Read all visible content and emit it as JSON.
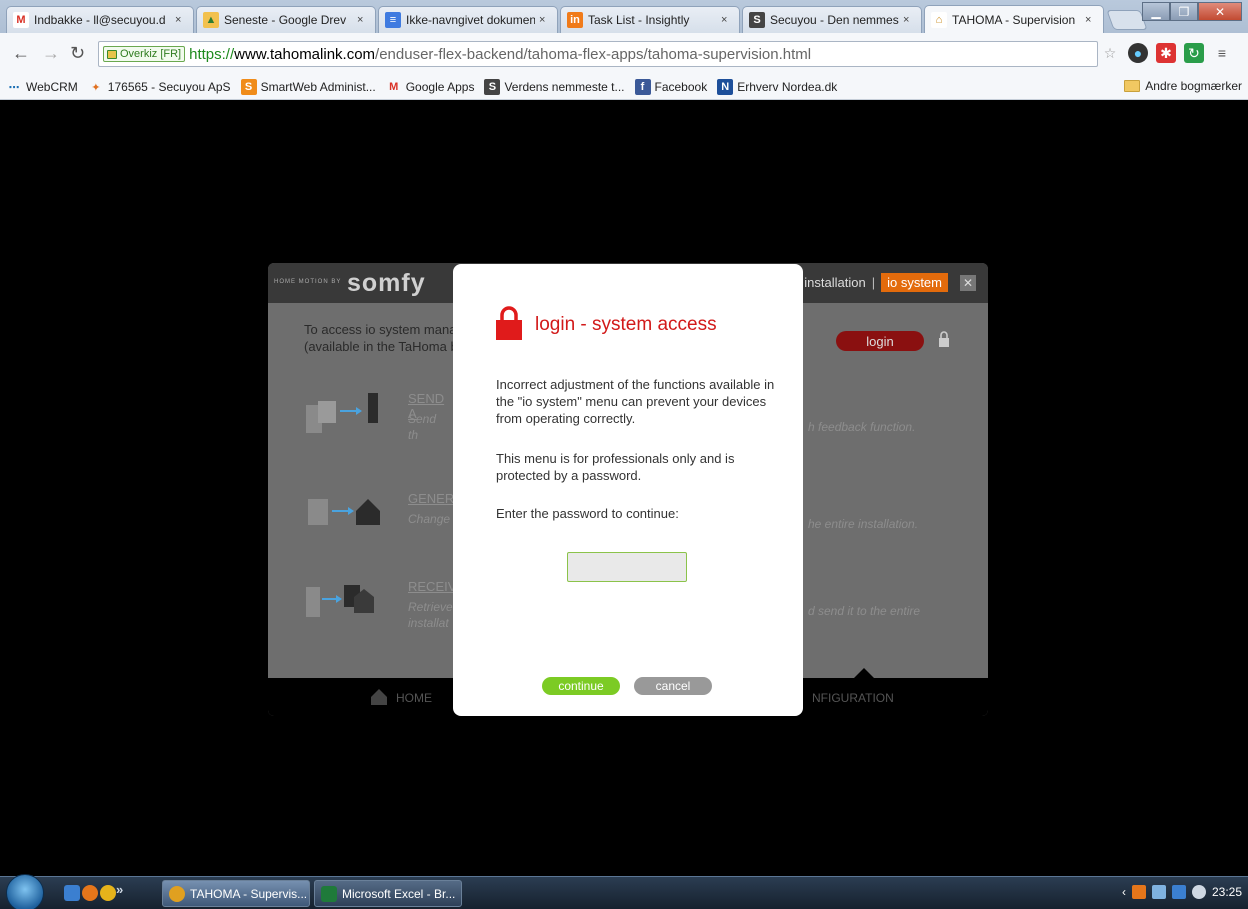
{
  "browser": {
    "tabs": [
      {
        "label": "Indbakke - ll@secuyou.d",
        "fav": "M",
        "favColor": "#d93025"
      },
      {
        "label": "Seneste - Google Drev",
        "fav": "▲",
        "favColor": "#3a9b3a"
      },
      {
        "label": "Ikke-navngivet dokumen",
        "fav": "≡",
        "favColor": "#3f7be0"
      },
      {
        "label": "Task List - Insightly",
        "fav": "in",
        "favColor": "#f07b1a"
      },
      {
        "label": "Secuyou - Den nemmest",
        "fav": "S",
        "favColor": "#444444"
      },
      {
        "label": "TAHOMA - Supervision",
        "fav": "⌂",
        "favColor": "#c98a1a"
      }
    ],
    "tab_close": "×",
    "omnibox": {
      "security_label": "Overkiz [FR]",
      "url_scheme": "https://",
      "url_host": "www.tahomalink.com",
      "url_path": "/enduser-flex-backend/tahoma-flex-apps/tahoma-supervision.html"
    },
    "bookmarks": [
      {
        "label": "WebCRM",
        "icon": "⋯",
        "color": "#1b6fb3"
      },
      {
        "label": "176565 - Secuyou ApS",
        "icon": "✦",
        "color": "#e07020"
      },
      {
        "label": "SmartWeb Administ...",
        "icon": "S",
        "color": "#f08c1a"
      },
      {
        "label": "Google Apps",
        "icon": "M",
        "color": "#d93025"
      },
      {
        "label": "Verdens nemmeste t...",
        "icon": "S",
        "color": "#444444"
      },
      {
        "label": "Facebook",
        "icon": "f",
        "color": "#3b5998"
      },
      {
        "label": "Erhverv Nordea.dk",
        "icon": "N",
        "color": "#1d4f9a"
      }
    ],
    "other_bookmarks": "Andre bogmærker"
  },
  "app": {
    "tagline": "HOME MOTION BY",
    "logo": "somfy",
    "nav": {
      "prev": "t",
      "installation": "installation",
      "io": "io system"
    },
    "close": "✕",
    "access_line1": "To access io system mana",
    "access_line2": "(available in the TaHoma b",
    "login": "login",
    "rows": [
      {
        "title": "SEND A",
        "desc1": "Send th",
        "desc2": "",
        "right": "h feedback function."
      },
      {
        "title": "GENER",
        "desc1": "Change",
        "desc2": "",
        "right": "he entire installation."
      },
      {
        "title": "RECEIV",
        "desc1": "Retrieve",
        "desc2": "installat",
        "right": "d send it to the entire"
      }
    ],
    "footer": {
      "home": "HOME",
      "config": "NFIGURATION"
    }
  },
  "modal": {
    "title": "login - system access",
    "p1": "Incorrect adjustment of the functions available in the \"io system\" menu can prevent your devices from operating correctly.",
    "p2": "This menu is for professionals only and is protected by a password.",
    "p3": "Enter the password to continue:",
    "password_value": "",
    "continue": "continue",
    "cancel": "cancel"
  },
  "taskbar": {
    "more": "»",
    "tasks": [
      {
        "label": "TAHOMA - Supervis...",
        "color": "#e0a020"
      },
      {
        "label": "Microsoft Excel - Br...",
        "color": "#1f7a3a"
      }
    ],
    "tray_left": "‹",
    "clock": "23:25"
  },
  "colors": {
    "accent_red": "#d21919",
    "io_orange": "#e36b0c",
    "continue_green": "#7ccb24"
  }
}
